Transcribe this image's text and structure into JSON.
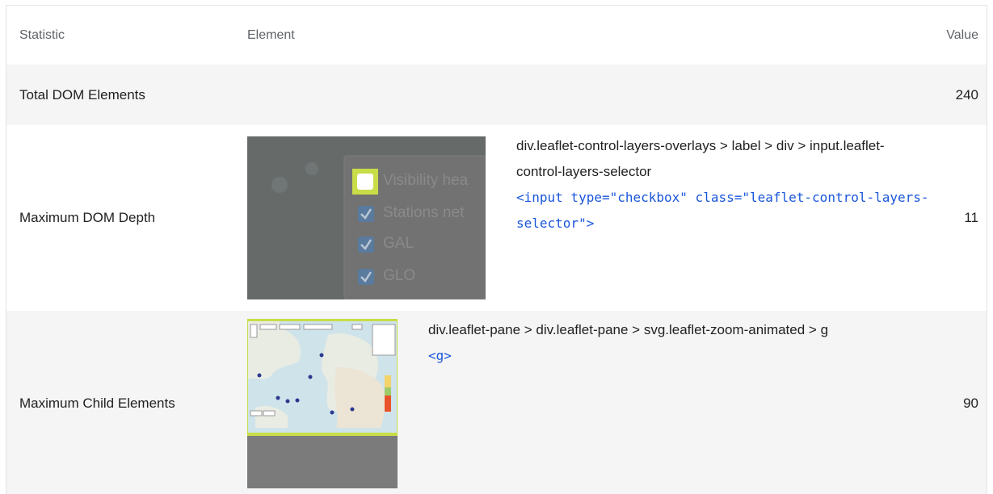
{
  "headers": {
    "statistic": "Statistic",
    "element": "Element",
    "value": "Value"
  },
  "rows": [
    {
      "statistic": "Total DOM Elements",
      "value": "240"
    },
    {
      "statistic": "Maximum DOM Depth",
      "value": "11",
      "path": "div.leaflet-control-layers-overlays > label > div > input.leaflet-control-layers-selector",
      "snippet": "<input type=\"checkbox\" class=\"leaflet-control-layers-selector\">",
      "thumb_labels": [
        "Visibility hea",
        "Stations net",
        "GAL",
        "GLO"
      ]
    },
    {
      "statistic": "Maximum Child Elements",
      "value": "90",
      "path": "div.leaflet-pane > div.leaflet-pane > svg.leaflet-zoom-animated > g",
      "snippet": "<g>"
    }
  ],
  "colors": {
    "highlight": "#c8dd47",
    "link": "#1a56db",
    "shaded_row": "#f5f5f5"
  }
}
